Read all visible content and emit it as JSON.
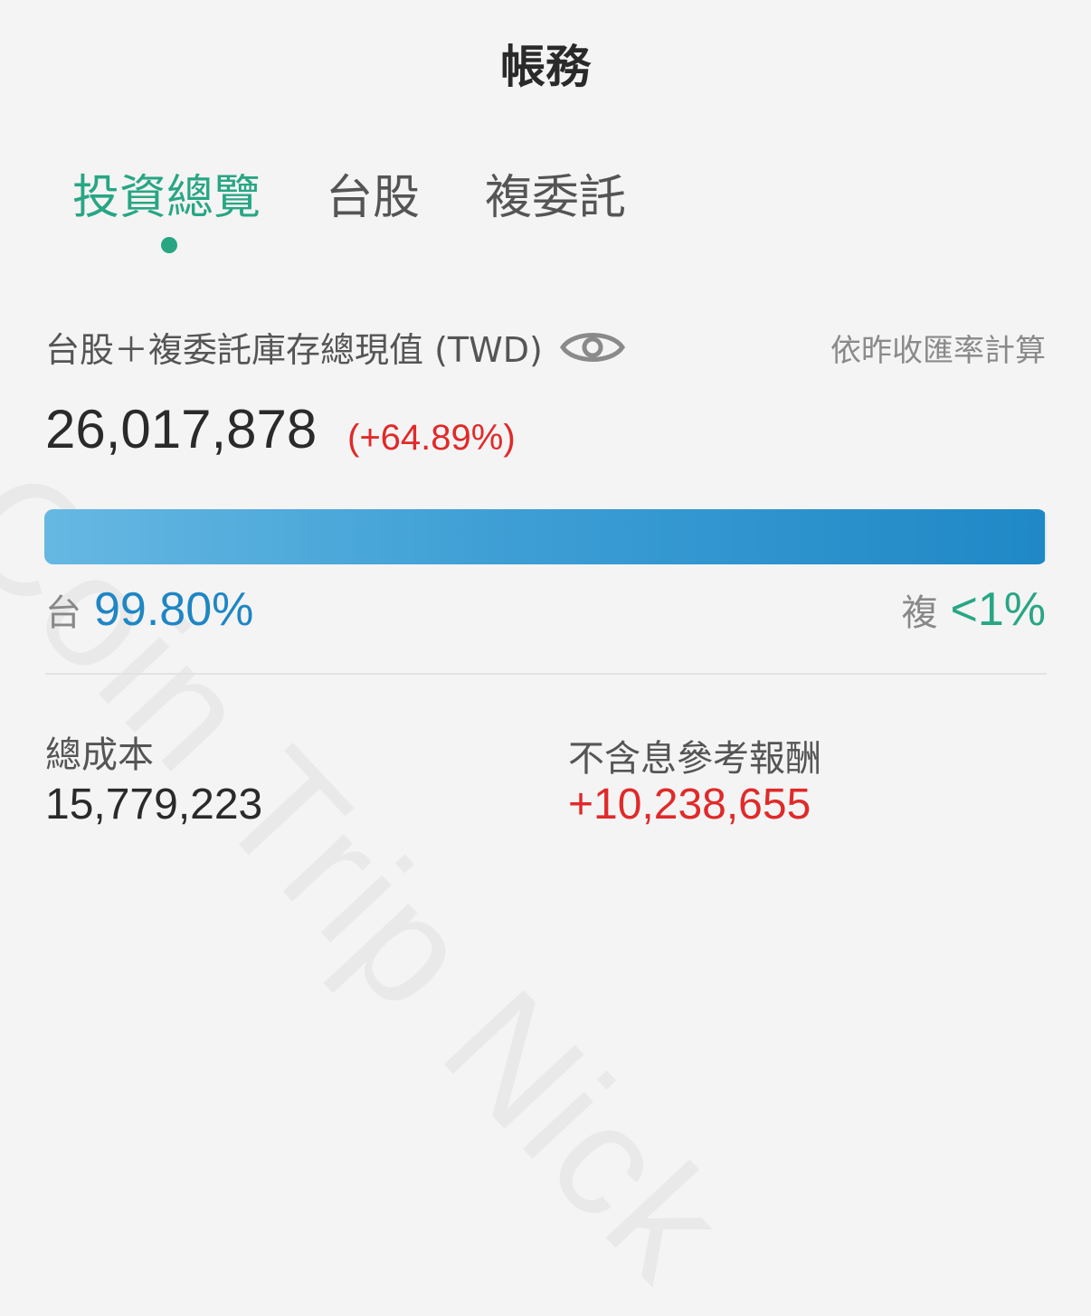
{
  "header": {
    "title": "帳務"
  },
  "tabs": [
    {
      "label": "投資總覽",
      "active": true
    },
    {
      "label": "台股",
      "active": false
    },
    {
      "label": "複委託",
      "active": false
    }
  ],
  "summary": {
    "label": "台股＋複委託庫存總現值 (TWD)",
    "visibility_icon": "eye-icon",
    "rate_note": "依昨收匯率計算",
    "total_value": "26,017,878",
    "total_change": "(+64.89%)"
  },
  "allocation": {
    "tw_label": "台",
    "tw_percent": "99.80%",
    "tw_fraction": 0.998,
    "overseas_label": "複",
    "overseas_percent": "<1%"
  },
  "cost": {
    "label": "總成本",
    "value": "15,779,223"
  },
  "return": {
    "label": "不含息參考報酬",
    "value": "+10,238,655"
  },
  "watermark": "Coin Trip Nick",
  "colors": {
    "accent_green": "#28a684",
    "loss_gain_red": "#e02a2a",
    "bar_blue": "#1f88c6",
    "tw_blue": "#1f86c4"
  }
}
